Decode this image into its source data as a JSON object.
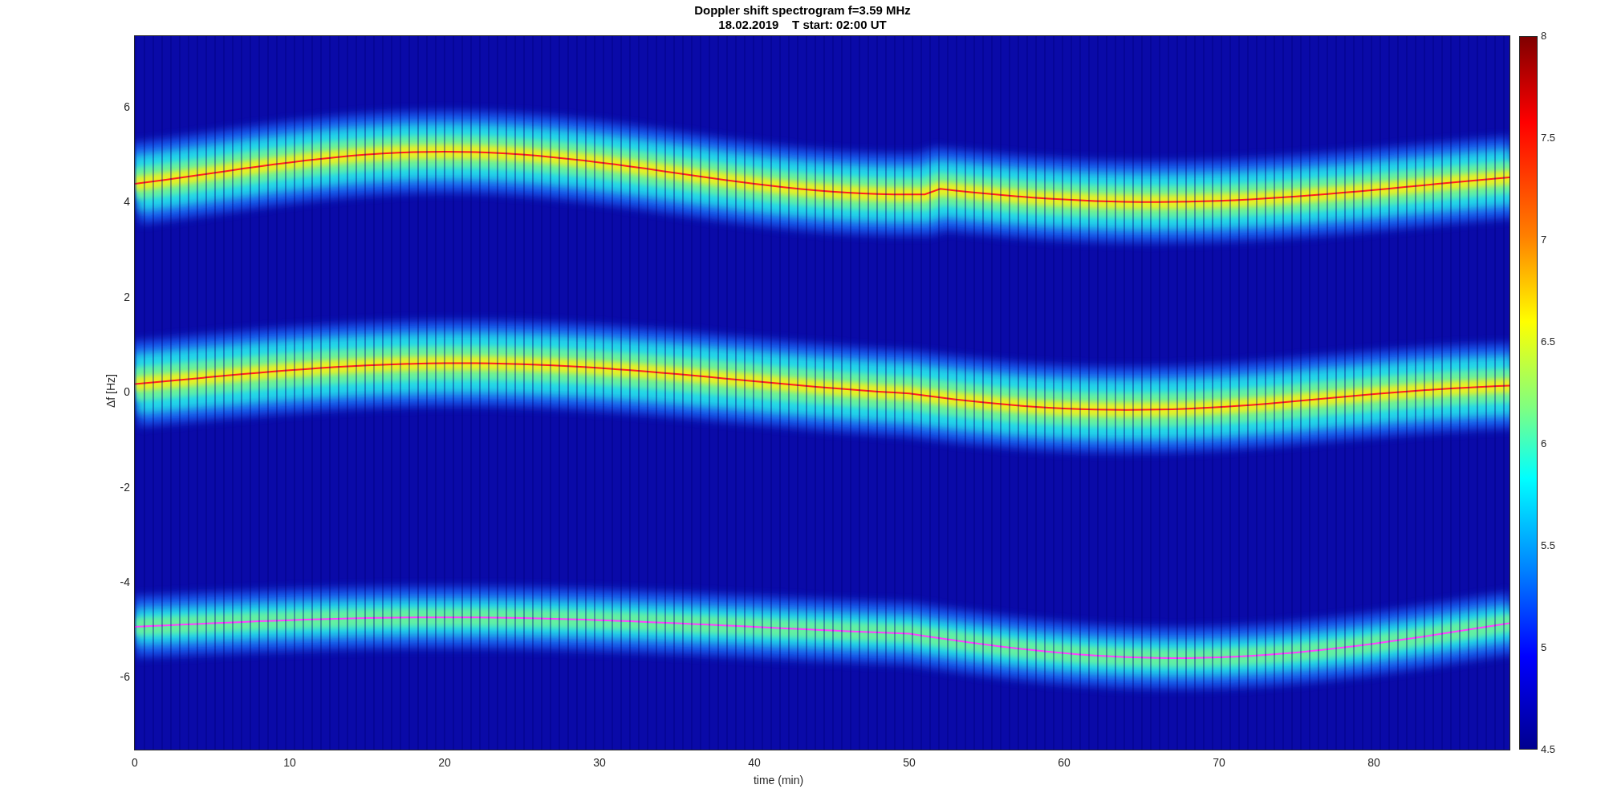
{
  "title": [
    "Doppler shift spectrogram f=3.59 MHz",
    "18.02.2019    T start: 02:00 UT"
  ],
  "axes": {
    "xlabel": "time (min)",
    "ylabel": "Δf [Hz]",
    "xticks": [
      "0",
      "10",
      "20",
      "30",
      "40",
      "50",
      "60",
      "70",
      "80"
    ],
    "yticks": [
      "6",
      "4",
      "2",
      "0",
      "-2",
      "-4",
      "-6"
    ]
  },
  "colorbar": {
    "ticks": [
      "8",
      "7.5",
      "7",
      "6.5",
      "6",
      "5.5",
      "5",
      "4.5"
    ]
  }
}
